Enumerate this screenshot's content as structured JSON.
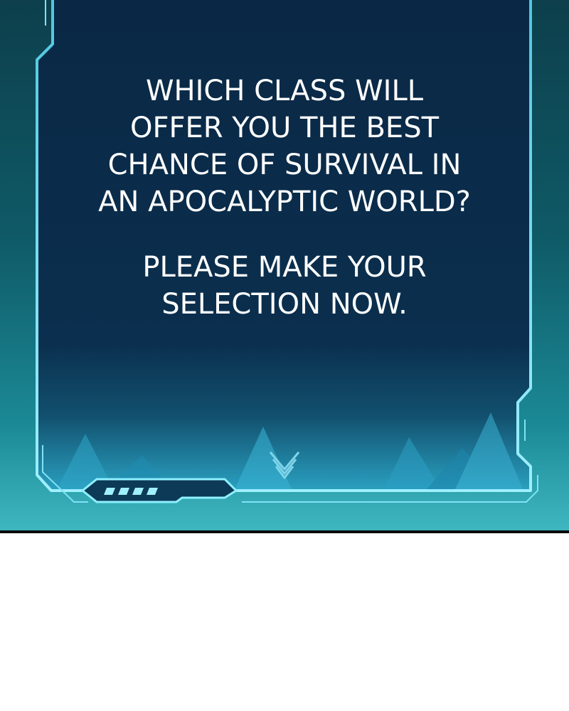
{
  "dialog": {
    "question_lines": [
      "WHICH CLASS WILL",
      "OFFER YOU THE BEST",
      "CHANCE OF SURVIVAL IN",
      "AN APOCALYPTIC WORLD?"
    ],
    "instruction_lines": [
      "PLEASE MAKE YOUR",
      "SELECTION NOW."
    ]
  },
  "colors": {
    "panel_fill": "#0b2a47",
    "frame_glow": "#7fe3f5",
    "background_teal": "#0f5a67",
    "text": "#ffffff"
  },
  "icons": {
    "frame_emblem": "chevron-down-icon"
  }
}
